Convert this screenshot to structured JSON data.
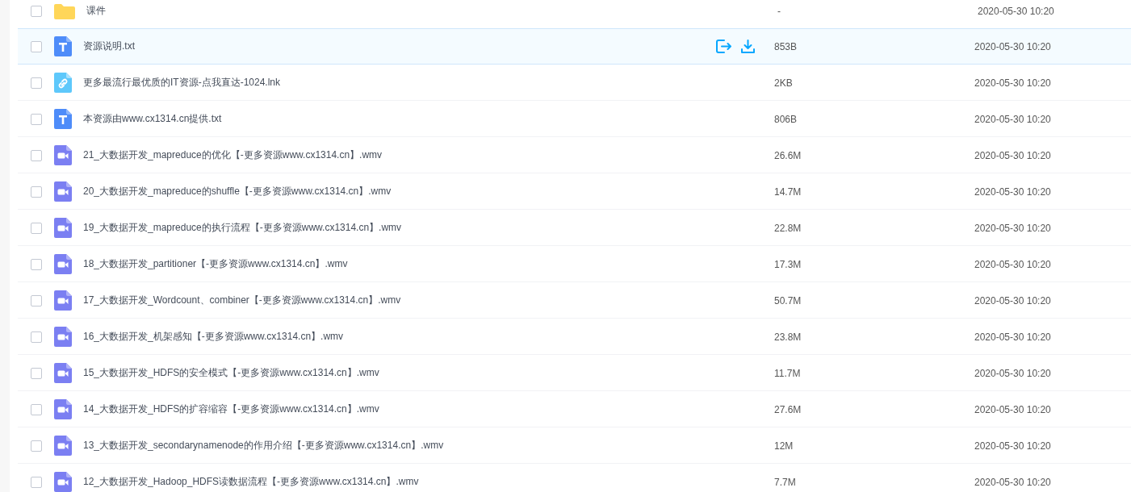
{
  "files": [
    {
      "kind": "folder",
      "name": "课件",
      "size": "-",
      "modified": "2020-05-30 10:20",
      "checked": false,
      "highlighted": false
    },
    {
      "kind": "text",
      "name": "资源说明.txt",
      "size": "853B",
      "modified": "2020-05-30 10:20",
      "checked": false,
      "highlighted": true
    },
    {
      "kind": "link",
      "name": "更多最流行最优质的IT资源-点我直达-1024.lnk",
      "size": "2KB",
      "modified": "2020-05-30 10:20",
      "checked": false,
      "highlighted": false
    },
    {
      "kind": "text",
      "name": "本资源由www.cx1314.cn提供.txt",
      "size": "806B",
      "modified": "2020-05-30 10:20",
      "checked": false,
      "highlighted": false
    },
    {
      "kind": "video",
      "name": "21_大数据开发_mapreduce的优化【-更多资源www.cx1314.cn】.wmv",
      "size": "26.6M",
      "modified": "2020-05-30 10:20",
      "checked": false,
      "highlighted": false
    },
    {
      "kind": "video",
      "name": "20_大数据开发_mapreduce的shuffle【-更多资源www.cx1314.cn】.wmv",
      "size": "14.7M",
      "modified": "2020-05-30 10:20",
      "checked": false,
      "highlighted": false
    },
    {
      "kind": "video",
      "name": "19_大数据开发_mapreduce的执行流程【-更多资源www.cx1314.cn】.wmv",
      "size": "22.8M",
      "modified": "2020-05-30 10:20",
      "checked": false,
      "highlighted": false
    },
    {
      "kind": "video",
      "name": "18_大数据开发_partitioner【-更多资源www.cx1314.cn】.wmv",
      "size": "17.3M",
      "modified": "2020-05-30 10:20",
      "checked": false,
      "highlighted": false
    },
    {
      "kind": "video",
      "name": "17_大数据开发_Wordcount、combiner【-更多资源www.cx1314.cn】.wmv",
      "size": "50.7M",
      "modified": "2020-05-30 10:20",
      "checked": false,
      "highlighted": false
    },
    {
      "kind": "video",
      "name": "16_大数据开发_机架感知【-更多资源www.cx1314.cn】.wmv",
      "size": "23.8M",
      "modified": "2020-05-30 10:20",
      "checked": false,
      "highlighted": false
    },
    {
      "kind": "video",
      "name": "15_大数据开发_HDFS的安全模式【-更多资源www.cx1314.cn】.wmv",
      "size": "11.7M",
      "modified": "2020-05-30 10:20",
      "checked": false,
      "highlighted": false
    },
    {
      "kind": "video",
      "name": "14_大数据开发_HDFS的扩容缩容【-更多资源www.cx1314.cn】.wmv",
      "size": "27.6M",
      "modified": "2020-05-30 10:20",
      "checked": false,
      "highlighted": false
    },
    {
      "kind": "video",
      "name": "13_大数据开发_secondarynamenode的作用介绍【-更多资源www.cx1314.cn】.wmv",
      "size": "12M",
      "modified": "2020-05-30 10:20",
      "checked": false,
      "highlighted": false
    },
    {
      "kind": "video",
      "name": "12_大数据开发_Hadoop_HDFS读数据流程【-更多资源www.cx1314.cn】.wmv",
      "size": "7.7M",
      "modified": "2020-05-30 10:20",
      "checked": false,
      "highlighted": false
    }
  ]
}
